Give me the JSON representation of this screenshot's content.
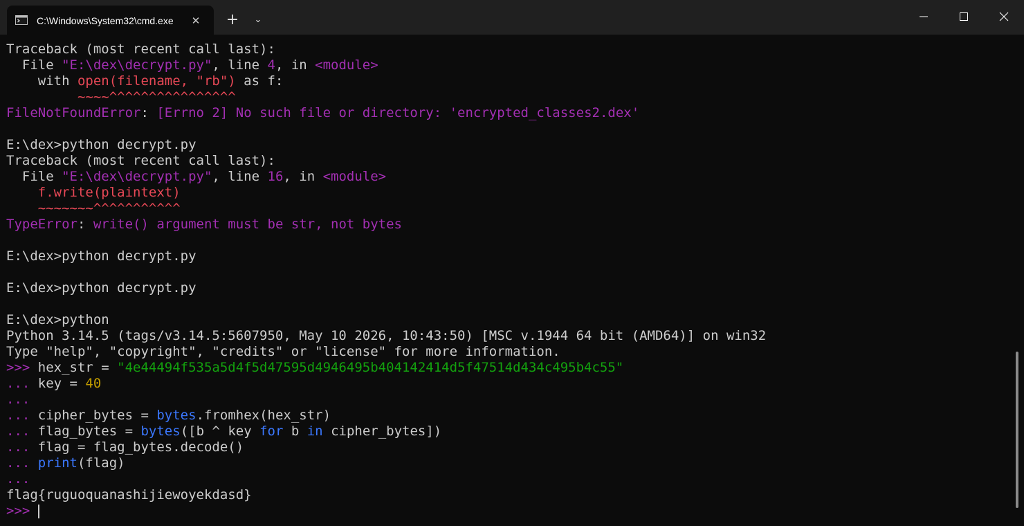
{
  "tab": {
    "title": "C:\\Windows\\System32\\cmd.exe",
    "close_glyph": "✕",
    "icon": "console-icon"
  },
  "toolbar": {
    "new_tab_glyph": "+",
    "dropdown_glyph": "⌄"
  },
  "window_controls": {
    "icons": [
      "minimize-icon",
      "maximize-icon",
      "close-icon"
    ]
  },
  "colors": {
    "background": "#0c0c0c",
    "titlebar": "#202020",
    "foreground": "#cccccc",
    "purple": "#a22fb2",
    "red": "#e74856",
    "green": "#13a10e",
    "yellow": "#c19c00",
    "blue": "#3b78ff"
  },
  "terminal": {
    "lines": [
      [
        {
          "t": "Traceback (most recent call last):",
          "c": ""
        }
      ],
      [
        {
          "t": "  File ",
          "c": ""
        },
        {
          "t": "\"E:\\dex\\decrypt.py\"",
          "c": "c-purple"
        },
        {
          "t": ", line ",
          "c": ""
        },
        {
          "t": "4",
          "c": "c-purple"
        },
        {
          "t": ", in ",
          "c": ""
        },
        {
          "t": "<module>",
          "c": "c-purple"
        }
      ],
      [
        {
          "t": "    with ",
          "c": ""
        },
        {
          "t": "open(filename, \"rb\")",
          "c": "c-red"
        },
        {
          "t": " as f:",
          "c": ""
        }
      ],
      [
        {
          "t": "         ~~~~^^^^^^^^^^^^^^^^",
          "c": "c-red"
        }
      ],
      [
        {
          "t": "FileNotFoundError",
          "c": "c-purple"
        },
        {
          "t": ": ",
          "c": ""
        },
        {
          "t": "[Errno 2] No such file or directory: 'encrypted_classes2.dex'",
          "c": "c-purple"
        }
      ],
      [
        {
          "t": "",
          "c": ""
        }
      ],
      [
        {
          "t": "E:\\dex>python decrypt.py",
          "c": ""
        }
      ],
      [
        {
          "t": "Traceback (most recent call last):",
          "c": ""
        }
      ],
      [
        {
          "t": "  File ",
          "c": ""
        },
        {
          "t": "\"E:\\dex\\decrypt.py\"",
          "c": "c-purple"
        },
        {
          "t": ", line ",
          "c": ""
        },
        {
          "t": "16",
          "c": "c-purple"
        },
        {
          "t": ", in ",
          "c": ""
        },
        {
          "t": "<module>",
          "c": "c-purple"
        }
      ],
      [
        {
          "t": "    f.write(plaintext)",
          "c": "c-red"
        }
      ],
      [
        {
          "t": "    ~~~~~~~^^^^^^^^^^^",
          "c": "c-red"
        }
      ],
      [
        {
          "t": "TypeError",
          "c": "c-purple"
        },
        {
          "t": ": ",
          "c": ""
        },
        {
          "t": "write() argument must be str, not bytes",
          "c": "c-purple"
        }
      ],
      [
        {
          "t": "",
          "c": ""
        }
      ],
      [
        {
          "t": "E:\\dex>python decrypt.py",
          "c": ""
        }
      ],
      [
        {
          "t": "",
          "c": ""
        }
      ],
      [
        {
          "t": "E:\\dex>python decrypt.py",
          "c": ""
        }
      ],
      [
        {
          "t": "",
          "c": ""
        }
      ],
      [
        {
          "t": "E:\\dex>python",
          "c": ""
        }
      ],
      [
        {
          "t": "Python 3.14.5 (tags/v3.14.5:5607950, May 10 2026, 10:43:50) [MSC v.1944 64 bit (AMD64)] on win32",
          "c": ""
        }
      ],
      [
        {
          "t": "Type \"help\", \"copyright\", \"credits\" or \"license\" for more information.",
          "c": ""
        }
      ],
      [
        {
          "t": ">>> ",
          "c": "c-purple"
        },
        {
          "t": "hex_str = ",
          "c": ""
        },
        {
          "t": "\"4e44494f535a5d4f5d47595d4946495b404142414d5f47514d434c495b4c55\"",
          "c": "c-green"
        }
      ],
      [
        {
          "t": "... ",
          "c": "c-purple"
        },
        {
          "t": "key = ",
          "c": ""
        },
        {
          "t": "40",
          "c": "c-yellow"
        }
      ],
      [
        {
          "t": "...",
          "c": "c-purple"
        }
      ],
      [
        {
          "t": "... ",
          "c": "c-purple"
        },
        {
          "t": "cipher_bytes = ",
          "c": ""
        },
        {
          "t": "bytes",
          "c": "c-blue"
        },
        {
          "t": ".fromhex(hex_str)",
          "c": ""
        }
      ],
      [
        {
          "t": "... ",
          "c": "c-purple"
        },
        {
          "t": "flag_bytes = ",
          "c": ""
        },
        {
          "t": "bytes",
          "c": "c-blue"
        },
        {
          "t": "([b ^ key ",
          "c": ""
        },
        {
          "t": "for",
          "c": "c-blue"
        },
        {
          "t": " b ",
          "c": ""
        },
        {
          "t": "in",
          "c": "c-blue"
        },
        {
          "t": " cipher_bytes])",
          "c": ""
        }
      ],
      [
        {
          "t": "... ",
          "c": "c-purple"
        },
        {
          "t": "flag = flag_bytes.decode()",
          "c": ""
        }
      ],
      [
        {
          "t": "... ",
          "c": "c-purple"
        },
        {
          "t": "print",
          "c": "c-blue"
        },
        {
          "t": "(flag)",
          "c": ""
        }
      ],
      [
        {
          "t": "...",
          "c": "c-purple"
        }
      ],
      [
        {
          "t": "flag{ruguoquanashijiewoyekdasd}",
          "c": ""
        }
      ],
      [
        {
          "t": ">>> ",
          "c": "c-purple"
        },
        {
          "t": "",
          "c": "cursor"
        }
      ]
    ]
  }
}
